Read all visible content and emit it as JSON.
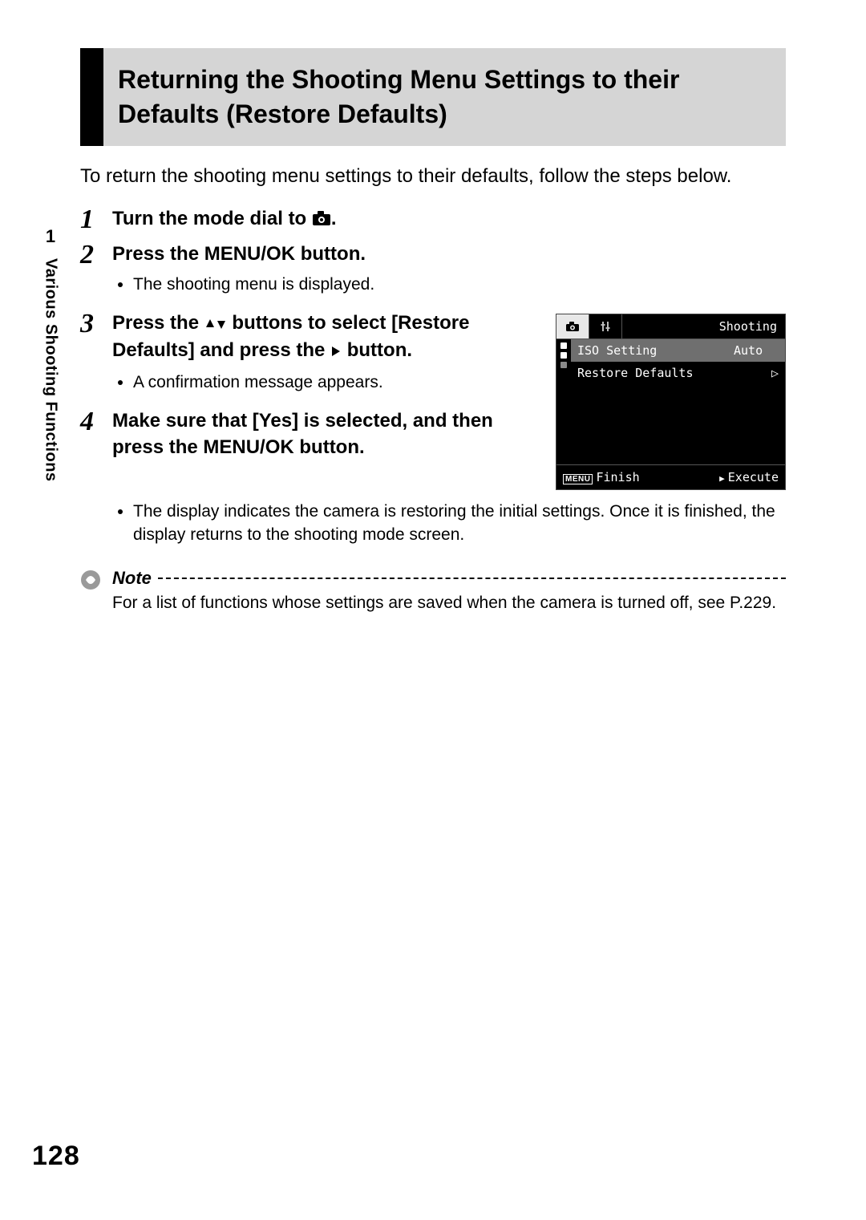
{
  "page_number": "128",
  "chapter_number": "1",
  "vertical_label": "Various Shooting Functions",
  "title": "Returning the Shooting Menu Settings to their Defaults (Restore Defaults)",
  "intro": "To return the shooting menu settings to their defaults, follow the steps below.",
  "steps": [
    {
      "num": "1",
      "headline_before_icon": "Turn the mode dial to ",
      "headline_after_icon": ".",
      "bullets": []
    },
    {
      "num": "2",
      "headline": "Press the MENU/OK button.",
      "bullets": [
        "The shooting menu is displayed."
      ]
    },
    {
      "num": "3",
      "headline_before": "Press the ",
      "headline_mid": " buttons to select [Restore Defaults] and press the ",
      "headline_after": " button.",
      "bullets": [
        "A confirmation message appears."
      ]
    },
    {
      "num": "4",
      "headline": "Make sure that [Yes] is selected, and then press the MENU/OK button.",
      "bullets": [
        "The display indicates the camera is restoring the initial settings. Once it is finished, the display returns to the shooting mode screen."
      ]
    }
  ],
  "lcd": {
    "tab_title": "Shooting",
    "rows": [
      {
        "label": "ISO Setting",
        "value": "Auto",
        "active": true
      },
      {
        "label": "Restore Defaults",
        "value": "",
        "chevron": true
      }
    ],
    "footer_left_badge": "MENU",
    "footer_left": "Finish",
    "footer_right": "Execute"
  },
  "note": {
    "title": "Note",
    "text": "For a list of functions whose settings are saved when the camera is turned off, see P.229."
  }
}
